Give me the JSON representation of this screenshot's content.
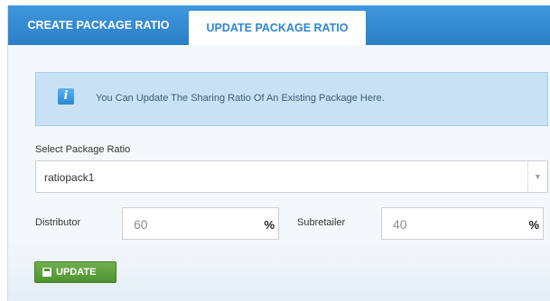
{
  "tabs": [
    {
      "label": "CREATE PACKAGE RATIO",
      "active": false
    },
    {
      "label": "UPDATE PACKAGE RATIO",
      "active": true
    }
  ],
  "info": {
    "icon": "info-icon",
    "text": "You Can Update The Sharing Ratio Of An Existing Package Here."
  },
  "package_select": {
    "label": "Select Package Ratio",
    "value": "ratiopack1"
  },
  "distributor": {
    "label": "Distributor",
    "placeholder": "60",
    "unit": "%"
  },
  "subretailer": {
    "label": "Subretailer",
    "placeholder": "40",
    "unit": "%"
  },
  "update_button": {
    "label": "UPDATE",
    "icon": "save-disk-icon"
  },
  "colors": {
    "tab_bar": "#2e86d1",
    "info_bg": "#c9e1f5",
    "button_green": "#5a9e3a"
  }
}
